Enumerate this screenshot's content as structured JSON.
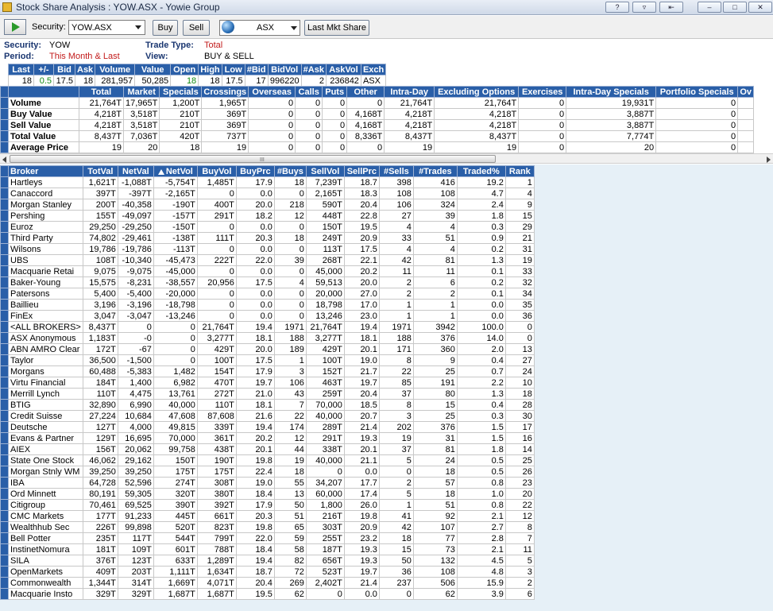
{
  "window": {
    "title": "Stock Share Analysis : YOW.ASX - Yowie Group"
  },
  "toolbar": {
    "security_label": "Security:",
    "security_value": "YOW.ASX",
    "buy_label": "Buy",
    "sell_label": "Sell",
    "exchange_value": "ASX",
    "last_mkt_share_label": "Last Mkt Share"
  },
  "info": {
    "security_label": "Security:",
    "security_value": "YOW",
    "period_label": "Period:",
    "period_value": "This Month & Last",
    "trade_type_label": "Trade Type:",
    "trade_type_value": "Total",
    "view_label": "View:",
    "view_value": "BUY & SELL"
  },
  "quote": {
    "headers": [
      "Last",
      "+/-",
      "Bid",
      "Ask",
      "Volume",
      "Value",
      "Open",
      "High",
      "Low",
      "#Bid",
      "BidVol",
      "#Ask",
      "AskVol",
      "Exch"
    ],
    "values": [
      "18",
      "0.5",
      "17.5",
      "18",
      "281,957",
      "50,285",
      "18",
      "18",
      "17.5",
      "17",
      "996220",
      "2",
      "236842",
      "ASX"
    ]
  },
  "summary": {
    "headers": [
      "",
      "Total",
      "Market",
      "Specials",
      "Crossings",
      "Overseas",
      "Calls",
      "Puts",
      "Other",
      "Intra-Day",
      "Excluding Options",
      "Exercises",
      "Intra-Day Specials",
      "Portfolio Specials",
      "Ov"
    ],
    "rows": [
      [
        "Volume",
        "21,764T",
        "17,965T",
        "1,200T",
        "1,965T",
        "0",
        "0",
        "0",
        "0",
        "21,764T",
        "21,764T",
        "0",
        "19,931T",
        "0",
        ""
      ],
      [
        "Buy Value",
        "4,218T",
        "3,518T",
        "210T",
        "369T",
        "0",
        "0",
        "0",
        "4,168T",
        "4,218T",
        "4,218T",
        "0",
        "3,887T",
        "0",
        ""
      ],
      [
        "Sell Value",
        "4,218T",
        "3,518T",
        "210T",
        "369T",
        "0",
        "0",
        "0",
        "4,168T",
        "4,218T",
        "4,218T",
        "0",
        "3,887T",
        "0",
        ""
      ],
      [
        "Total Value",
        "8,437T",
        "7,036T",
        "420T",
        "737T",
        "0",
        "0",
        "0",
        "8,336T",
        "8,437T",
        "8,437T",
        "0",
        "7,774T",
        "0",
        ""
      ],
      [
        "Average Price",
        "19",
        "20",
        "18",
        "19",
        "0",
        "0",
        "0",
        "0",
        "19",
        "19",
        "0",
        "20",
        "0",
        ""
      ]
    ]
  },
  "scrollbar": {
    "grip": "III"
  },
  "brokers": {
    "headers": [
      "Broker",
      "TotVal",
      "NetVal",
      "NetVol",
      "BuyVol",
      "BuyPrc",
      "#Buys",
      "SellVol",
      "SellPrc",
      "#Sells",
      "#Trades",
      "Traded%",
      "Rank"
    ],
    "rows": [
      [
        "Hartleys",
        "1,621T",
        "-1,088T",
        "-5,754T",
        "1,485T",
        "17.9",
        "18",
        "7,239T",
        "18.7",
        "398",
        "416",
        "19.2",
        "1"
      ],
      [
        "Canaccord",
        "397T",
        "-397T",
        "-2,165T",
        "0",
        "0.0",
        "0",
        "2,165T",
        "18.3",
        "108",
        "108",
        "4.7",
        "4"
      ],
      [
        "Morgan Stanley",
        "200T",
        "-40,358",
        "-190T",
        "400T",
        "20.0",
        "218",
        "590T",
        "20.4",
        "106",
        "324",
        "2.4",
        "9"
      ],
      [
        "Pershing",
        "155T",
        "-49,097",
        "-157T",
        "291T",
        "18.2",
        "12",
        "448T",
        "22.8",
        "27",
        "39",
        "1.8",
        "15"
      ],
      [
        "Euroz",
        "29,250",
        "-29,250",
        "-150T",
        "0",
        "0.0",
        "0",
        "150T",
        "19.5",
        "4",
        "4",
        "0.3",
        "29"
      ],
      [
        "Third Party",
        "74,802",
        "-29,461",
        "-138T",
        "111T",
        "20.3",
        "18",
        "249T",
        "20.9",
        "33",
        "51",
        "0.9",
        "21"
      ],
      [
        "Wilsons",
        "19,786",
        "-19,786",
        "-113T",
        "0",
        "0.0",
        "0",
        "113T",
        "17.5",
        "4",
        "4",
        "0.2",
        "31"
      ],
      [
        "UBS",
        "108T",
        "-10,340",
        "-45,473",
        "222T",
        "22.0",
        "39",
        "268T",
        "22.1",
        "42",
        "81",
        "1.3",
        "19"
      ],
      [
        "Macquarie Retai",
        "9,075",
        "-9,075",
        "-45,000",
        "0",
        "0.0",
        "0",
        "45,000",
        "20.2",
        "11",
        "11",
        "0.1",
        "33"
      ],
      [
        "Baker-Young",
        "15,575",
        "-8,231",
        "-38,557",
        "20,956",
        "17.5",
        "4",
        "59,513",
        "20.0",
        "2",
        "6",
        "0.2",
        "32"
      ],
      [
        "Patersons",
        "5,400",
        "-5,400",
        "-20,000",
        "0",
        "0.0",
        "0",
        "20,000",
        "27.0",
        "2",
        "2",
        "0.1",
        "34"
      ],
      [
        "Baillieu",
        "3,196",
        "-3,196",
        "-18,798",
        "0",
        "0.0",
        "0",
        "18,798",
        "17.0",
        "1",
        "1",
        "0.0",
        "35"
      ],
      [
        "FinEx",
        "3,047",
        "-3,047",
        "-13,246",
        "0",
        "0.0",
        "0",
        "13,246",
        "23.0",
        "1",
        "1",
        "0.0",
        "36"
      ],
      [
        "<ALL BROKERS>",
        "8,437T",
        "0",
        "0",
        "21,764T",
        "19.4",
        "1971",
        "21,764T",
        "19.4",
        "1971",
        "3942",
        "100.0",
        "0"
      ],
      [
        "ASX Anonymous",
        "1,183T",
        "-0",
        "0",
        "3,277T",
        "18.1",
        "188",
        "3,277T",
        "18.1",
        "188",
        "376",
        "14.0",
        "0"
      ],
      [
        "ABN AMRO Clear",
        "172T",
        "-67",
        "0",
        "429T",
        "20.0",
        "189",
        "429T",
        "20.1",
        "171",
        "360",
        "2.0",
        "13"
      ],
      [
        "Taylor",
        "36,500",
        "-1,500",
        "0",
        "100T",
        "17.5",
        "1",
        "100T",
        "19.0",
        "8",
        "9",
        "0.4",
        "27"
      ],
      [
        "Morgans",
        "60,488",
        "-5,383",
        "1,482",
        "154T",
        "17.9",
        "3",
        "152T",
        "21.7",
        "22",
        "25",
        "0.7",
        "24"
      ],
      [
        "Virtu Financial",
        "184T",
        "1,400",
        "6,982",
        "470T",
        "19.7",
        "106",
        "463T",
        "19.7",
        "85",
        "191",
        "2.2",
        "10"
      ],
      [
        "Merrill Lynch",
        "110T",
        "4,475",
        "13,761",
        "272T",
        "21.0",
        "43",
        "259T",
        "20.4",
        "37",
        "80",
        "1.3",
        "18"
      ],
      [
        "BTIG",
        "32,890",
        "6,990",
        "40,000",
        "110T",
        "18.1",
        "7",
        "70,000",
        "18.5",
        "8",
        "15",
        "0.4",
        "28"
      ],
      [
        "Credit Suisse",
        "27,224",
        "10,684",
        "47,608",
        "87,608",
        "21.6",
        "22",
        "40,000",
        "20.7",
        "3",
        "25",
        "0.3",
        "30"
      ],
      [
        "Deutsche",
        "127T",
        "4,000",
        "49,815",
        "339T",
        "19.4",
        "174",
        "289T",
        "21.4",
        "202",
        "376",
        "1.5",
        "17"
      ],
      [
        "Evans & Partner",
        "129T",
        "16,695",
        "70,000",
        "361T",
        "20.2",
        "12",
        "291T",
        "19.3",
        "19",
        "31",
        "1.5",
        "16"
      ],
      [
        "AIEX",
        "156T",
        "20,062",
        "99,758",
        "438T",
        "20.1",
        "44",
        "338T",
        "20.1",
        "37",
        "81",
        "1.8",
        "14"
      ],
      [
        "State One Stock",
        "46,062",
        "29,162",
        "150T",
        "190T",
        "19.8",
        "19",
        "40,000",
        "21.1",
        "5",
        "24",
        "0.5",
        "25"
      ],
      [
        "Morgan Stnly WM",
        "39,250",
        "39,250",
        "175T",
        "175T",
        "22.4",
        "18",
        "0",
        "0.0",
        "0",
        "18",
        "0.5",
        "26"
      ],
      [
        "IBA",
        "64,728",
        "52,596",
        "274T",
        "308T",
        "19.0",
        "55",
        "34,207",
        "17.7",
        "2",
        "57",
        "0.8",
        "23"
      ],
      [
        "Ord Minnett",
        "80,191",
        "59,305",
        "320T",
        "380T",
        "18.4",
        "13",
        "60,000",
        "17.4",
        "5",
        "18",
        "1.0",
        "20"
      ],
      [
        "Citigroup",
        "70,461",
        "69,525",
        "390T",
        "392T",
        "17.9",
        "50",
        "1,800",
        "26.0",
        "1",
        "51",
        "0.8",
        "22"
      ],
      [
        "CMC Markets",
        "177T",
        "91,233",
        "445T",
        "661T",
        "20.3",
        "51",
        "216T",
        "19.8",
        "41",
        "92",
        "2.1",
        "12"
      ],
      [
        "Wealthhub Sec",
        "226T",
        "99,898",
        "520T",
        "823T",
        "19.8",
        "65",
        "303T",
        "20.9",
        "42",
        "107",
        "2.7",
        "8"
      ],
      [
        "Bell Potter",
        "235T",
        "117T",
        "544T",
        "799T",
        "22.0",
        "59",
        "255T",
        "23.2",
        "18",
        "77",
        "2.8",
        "7"
      ],
      [
        "InstinetNomura",
        "181T",
        "109T",
        "601T",
        "788T",
        "18.4",
        "58",
        "187T",
        "19.3",
        "15",
        "73",
        "2.1",
        "11"
      ],
      [
        "SILA",
        "376T",
        "123T",
        "633T",
        "1,289T",
        "19.4",
        "82",
        "656T",
        "19.3",
        "50",
        "132",
        "4.5",
        "5"
      ],
      [
        "OpenMarkets",
        "409T",
        "203T",
        "1,111T",
        "1,634T",
        "18.7",
        "72",
        "523T",
        "19.7",
        "36",
        "108",
        "4.8",
        "3"
      ],
      [
        "Commonwealth",
        "1,344T",
        "314T",
        "1,669T",
        "4,071T",
        "20.4",
        "269",
        "2,402T",
        "21.4",
        "237",
        "506",
        "15.9",
        "2"
      ],
      [
        "Macquarie Insto",
        "329T",
        "329T",
        "1,687T",
        "1,687T",
        "19.5",
        "62",
        "0",
        "0.0",
        "0",
        "62",
        "3.9",
        "6"
      ]
    ]
  },
  "colors": {
    "header_blue": "#2a5fa8",
    "label_navy": "#1a3670",
    "accent_red": "#c21a1a",
    "positive_green": "#138a13"
  }
}
